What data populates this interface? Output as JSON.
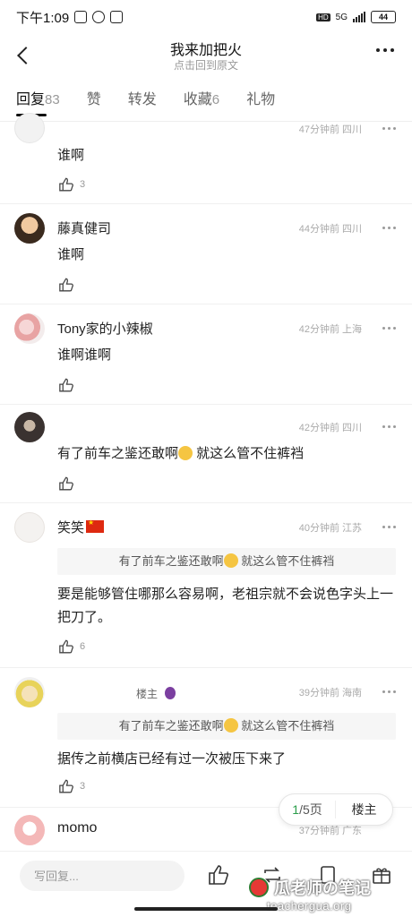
{
  "status_bar": {
    "time": "下午1:09",
    "network": "5G",
    "battery": "44",
    "hd": "HD"
  },
  "header": {
    "title": "我来加把火",
    "subtitle": "点击回到原文"
  },
  "tabs": [
    {
      "label": "回复",
      "count": "83"
    },
    {
      "label": "赞",
      "count": ""
    },
    {
      "label": "转发",
      "count": ""
    },
    {
      "label": "收藏",
      "count": "6"
    },
    {
      "label": "礼物",
      "count": ""
    }
  ],
  "comments": [
    {
      "nickname": "",
      "meta": "47分钟前  四川",
      "content": "谁啊",
      "likes": "3"
    },
    {
      "nickname": "藤真健司",
      "meta": "44分钟前  四川",
      "content": "谁啊",
      "likes": ""
    },
    {
      "nickname": "Tony家的小辣椒",
      "meta": "42分钟前  上海",
      "content": "谁啊谁啊",
      "likes": ""
    },
    {
      "nickname": "",
      "meta": "42分钟前  四川",
      "content_a": "有了前车之鉴还敢啊",
      "content_b": " 就这么管不住裤裆",
      "likes": ""
    },
    {
      "nickname": "笑笑",
      "meta": "40分钟前  江苏",
      "quote_a": "有了前车之鉴还敢啊",
      "quote_b": " 就这么管不住裤裆",
      "content": "要是能够管住哪那么容易啊，老祖宗就不会说色字头上一把刀了。",
      "likes": "6"
    },
    {
      "nickname": "",
      "tag": "楼主",
      "meta": "39分钟前  海南",
      "quote_a": "有了前车之鉴还敢啊",
      "quote_b": " 就这么管不住裤裆",
      "content": "据传之前横店已经有过一次被压下来了",
      "likes": "3"
    },
    {
      "nickname": "momo",
      "meta": "37分钟前  广东"
    }
  ],
  "pager": {
    "current": "1",
    "total": "/5页",
    "louzhu": "楼主"
  },
  "bottom_bar": {
    "reply_placeholder": "写回复..."
  },
  "watermark": {
    "title": "瓜老师の笔记",
    "url": "teachergua.org"
  }
}
